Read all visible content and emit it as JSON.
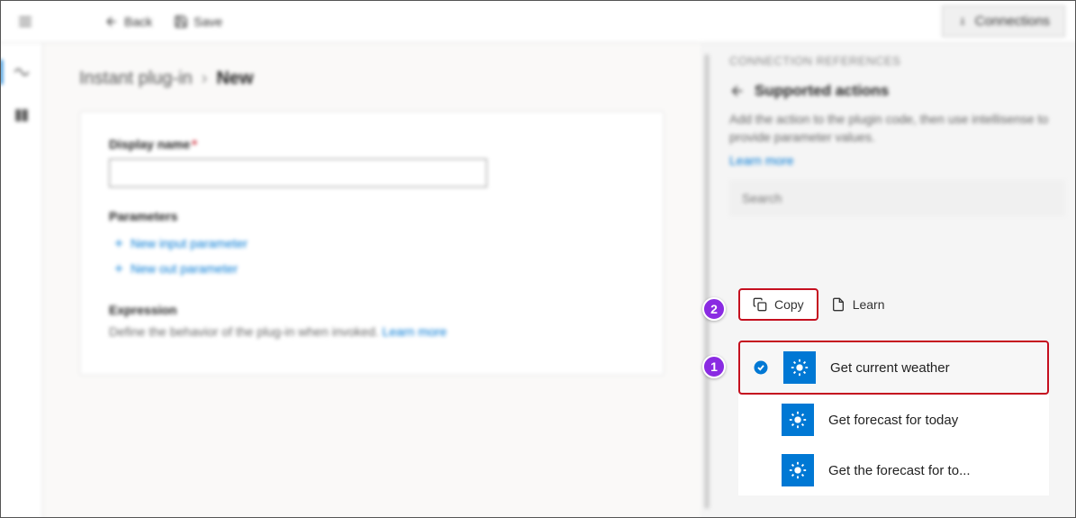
{
  "topbar": {
    "back": "Back",
    "save": "Save",
    "connections": "Connections"
  },
  "breadcrumb": {
    "parent": "Instant plug-in",
    "current": "New"
  },
  "form": {
    "display_name_label": "Display name",
    "parameters_label": "Parameters",
    "new_input": "New input parameter",
    "new_out": "New out parameter",
    "expression_label": "Expression",
    "expression_desc": "Define the behavior of the plug-in when invoked.",
    "learn_more": "Learn more"
  },
  "right": {
    "title": "CONNECTION REFERENCES",
    "subtitle": "Supported actions",
    "desc": "Add the action to the plugin code, then use intellisense to provide parameter values.",
    "learn_more": "Learn more",
    "search_placeholder": "Search",
    "copy": "Copy",
    "learn": "Learn",
    "actions": [
      "Get current weather",
      "Get forecast for today",
      "Get the forecast for to..."
    ]
  },
  "callouts": {
    "one": "1",
    "two": "2"
  }
}
